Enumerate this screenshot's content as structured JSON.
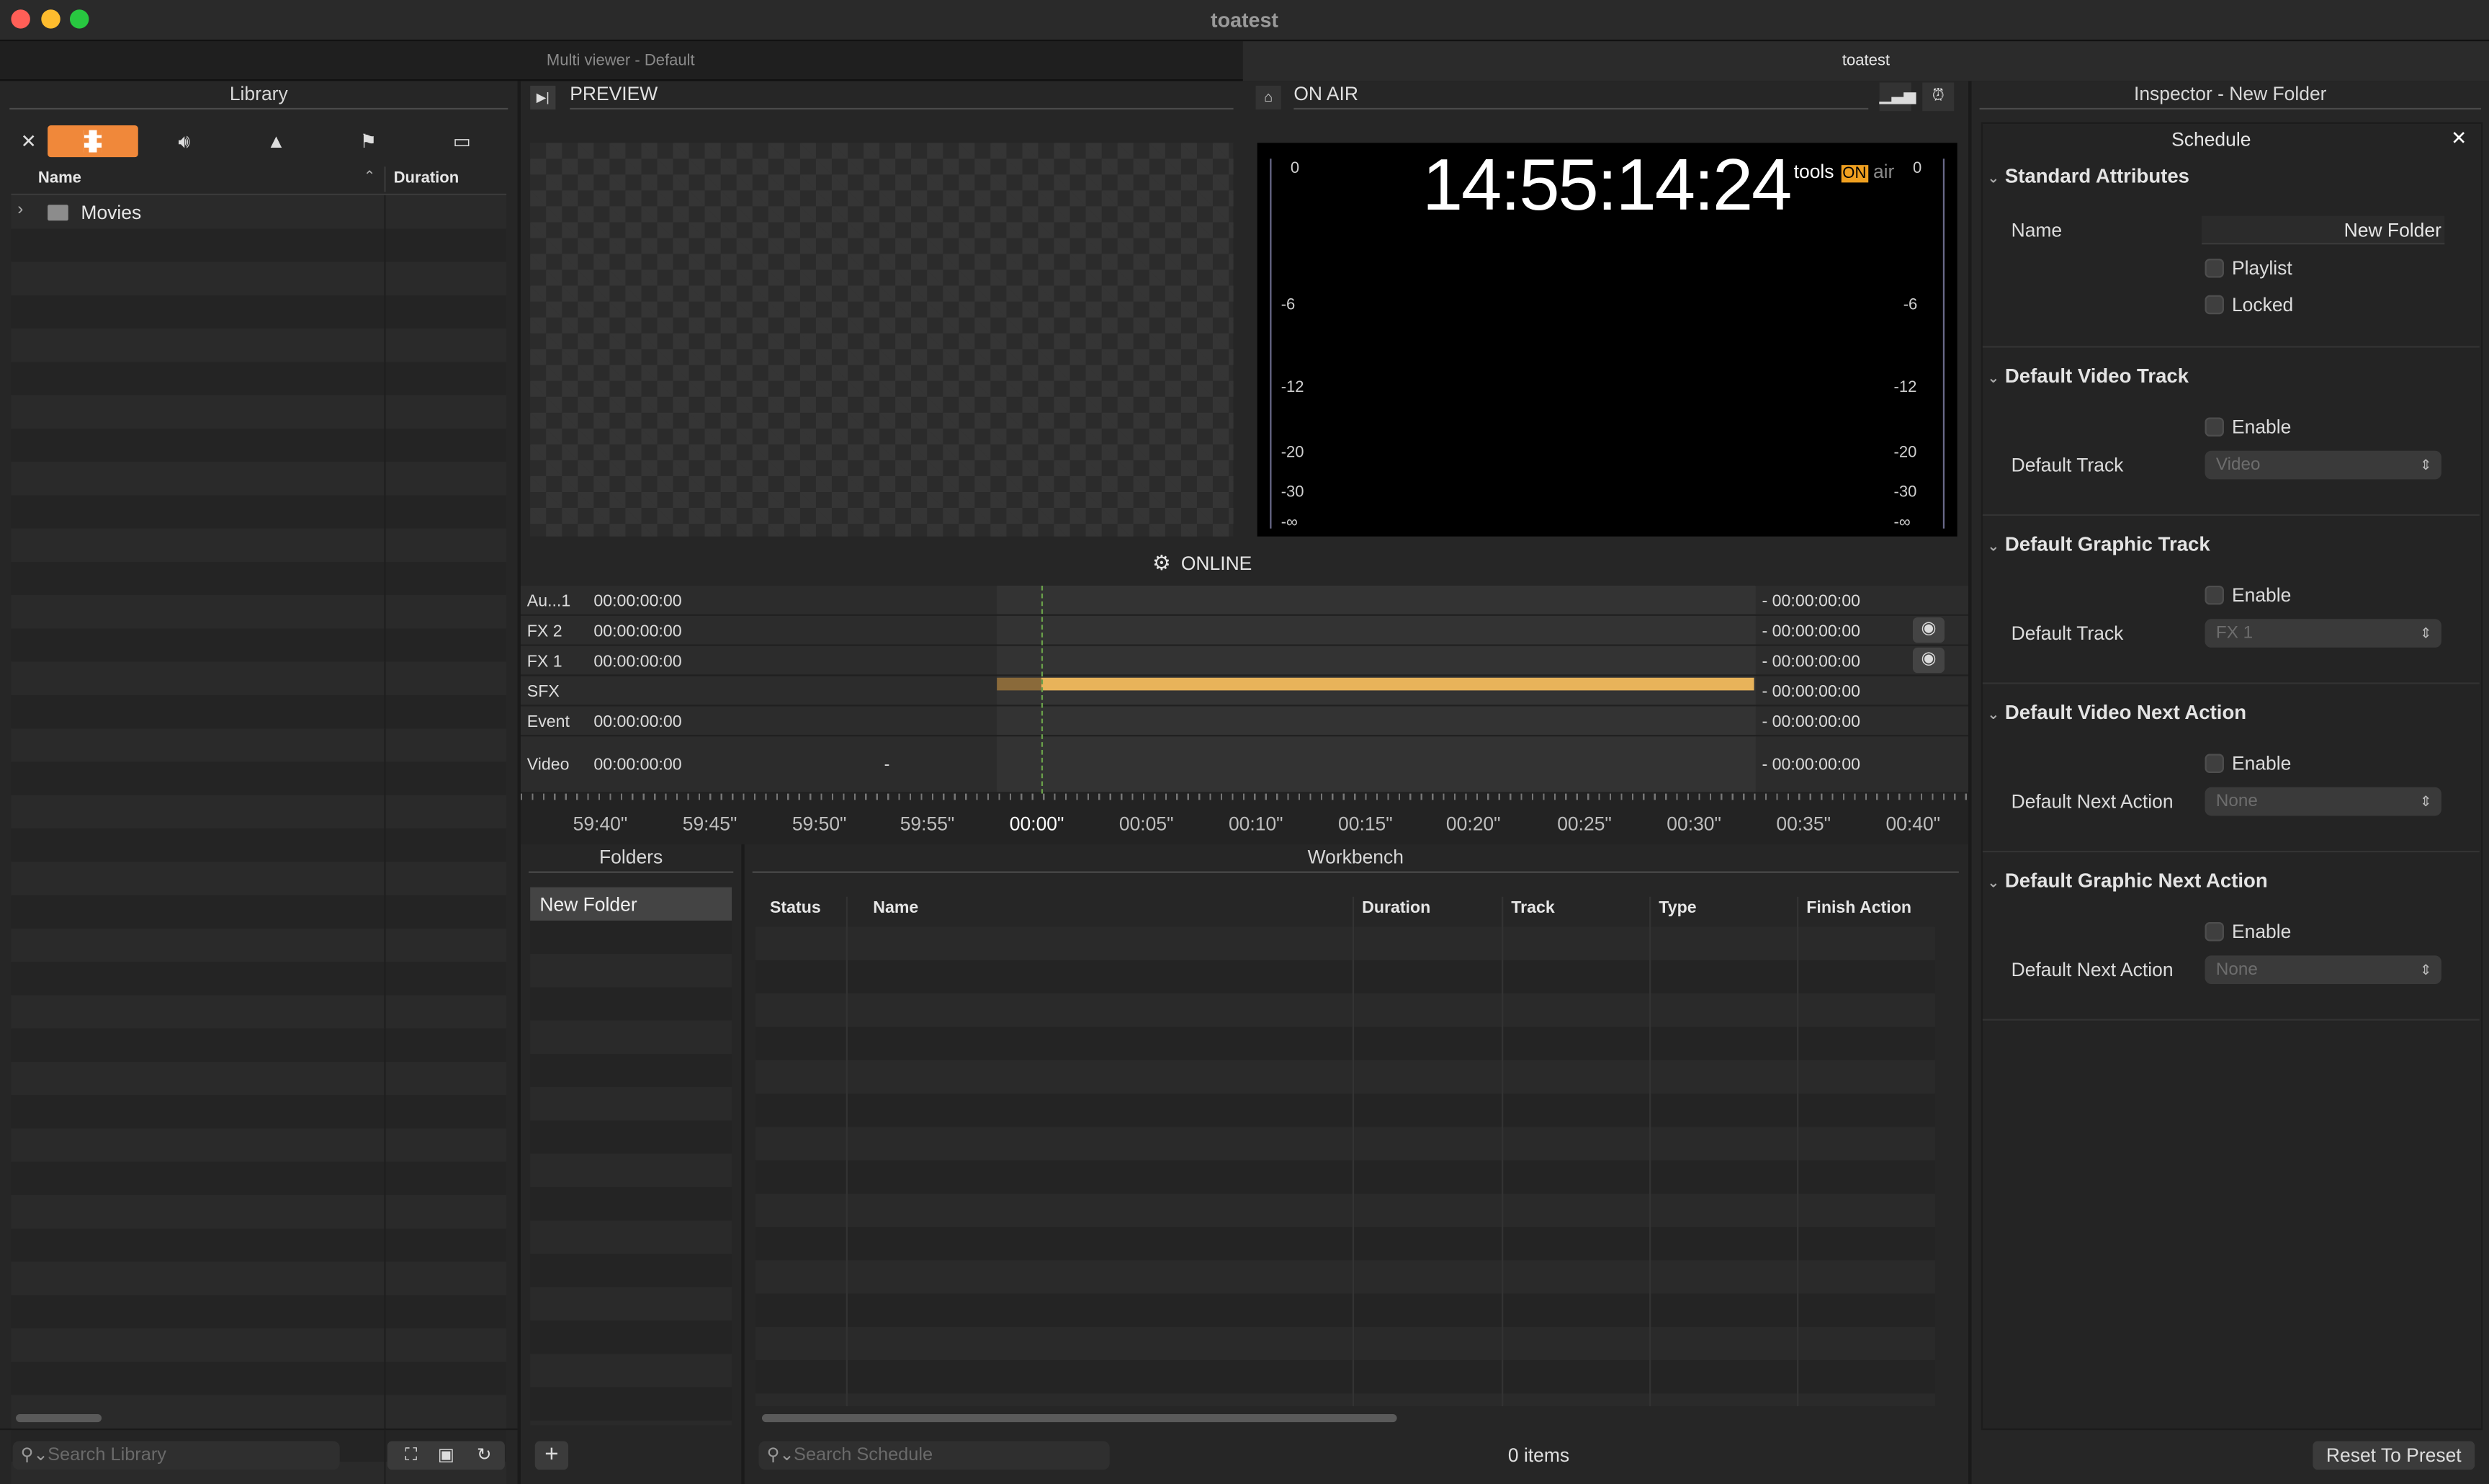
{
  "window": {
    "title": "toatest",
    "colors": {
      "close": "#ff5f57",
      "minimize": "#febc2e",
      "zoom": "#28c840",
      "accent": "#f0883a",
      "timeline_bar": "#e8b35a",
      "clock_badge": "#f0a020"
    }
  },
  "tabs": [
    {
      "label": "Multi viewer - Default"
    },
    {
      "label": "toatest"
    }
  ],
  "library": {
    "title": "Library",
    "filter_icons": [
      "close-icon",
      "film-icon",
      "speaker-icon",
      "mountain-image-icon",
      "flag-icon",
      "calendar-icon"
    ],
    "columns": {
      "name": "Name",
      "duration": "Duration"
    },
    "rows": [
      {
        "name": "Movies",
        "icon": "folder-icon"
      }
    ],
    "search_placeholder": "Search Library"
  },
  "preview": {
    "title": "PREVIEW"
  },
  "onair": {
    "title": "ON AIR",
    "clock": "14:55:14:24",
    "brand": "tools",
    "badge": "ON",
    "brand_tail": "air",
    "meter_left": [
      "0",
      "-6",
      "-12",
      "-20",
      "-30",
      "-∞"
    ],
    "meter_right": [
      "0",
      "-6",
      "-12",
      "-20",
      "-30",
      "-∞"
    ]
  },
  "status": {
    "label": "ONLINE"
  },
  "timeline": {
    "tracks": [
      {
        "label": "Au...1",
        "start": "00:00:00:00",
        "end": "- 00:00:00:00",
        "eye": false
      },
      {
        "label": "FX 2",
        "start": "00:00:00:00",
        "end": "- 00:00:00:00",
        "eye": true
      },
      {
        "label": "FX 1",
        "start": "00:00:00:00",
        "end": "- 00:00:00:00",
        "eye": true
      },
      {
        "label": "SFX",
        "start": "",
        "end": "- 00:00:00:00",
        "eye": false
      },
      {
        "label": "Event",
        "start": "00:00:00:00",
        "end": "- 00:00:00:00",
        "eye": false
      },
      {
        "label": "Video",
        "start": "00:00:00:00",
        "end": "- 00:00:00:00",
        "eye": false,
        "extra": "-"
      }
    ],
    "ruler": [
      "59:40\"",
      "59:45\"",
      "59:50\"",
      "59:55\"",
      "00:00\"",
      "00:05\"",
      "00:10\"",
      "00:15\"",
      "00:20\"",
      "00:25\"",
      "00:30\"",
      "00:35\"",
      "00:40\""
    ]
  },
  "folders": {
    "title": "Folders",
    "items": [
      "New Folder"
    ]
  },
  "workbench": {
    "title": "Workbench",
    "columns": [
      "Status",
      "Name",
      "Duration",
      "Track",
      "Type",
      "Finish Action"
    ],
    "search_placeholder": "Search Schedule",
    "count": "0 items"
  },
  "inspector": {
    "title": "Inspector - New Folder",
    "tab": "Schedule",
    "sections": {
      "standard": {
        "title": "Standard Attributes",
        "name_label": "Name",
        "name_value": "New Folder",
        "playlist": "Playlist",
        "locked": "Locked"
      },
      "video_track": {
        "title": "Default Video Track",
        "enable": "Enable",
        "track_label": "Default Track",
        "track_value": "Video"
      },
      "graphic_track": {
        "title": "Default Graphic Track",
        "enable": "Enable",
        "track_label": "Default Track",
        "track_value": "FX 1"
      },
      "video_next": {
        "title": "Default Video Next Action",
        "enable": "Enable",
        "label": "Default Next Action",
        "value": "None"
      },
      "graphic_next": {
        "title": "Default Graphic Next Action",
        "enable": "Enable",
        "label": "Default Next Action",
        "value": "None"
      }
    },
    "reset": "Reset To Preset"
  }
}
